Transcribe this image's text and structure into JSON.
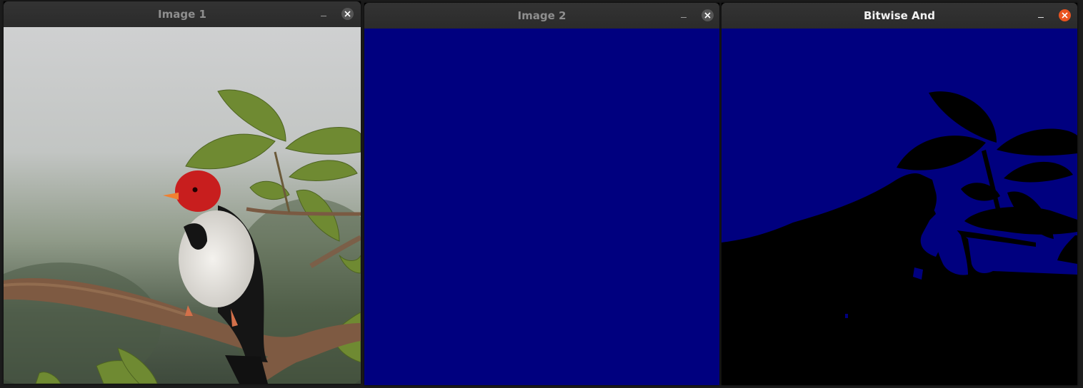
{
  "windows": [
    {
      "title": "Image 1",
      "active": false,
      "image": "bird-on-branch-photo"
    },
    {
      "title": "Image 2",
      "active": false,
      "image": "solid-blue-fill",
      "fill_color": "#00007f"
    },
    {
      "title": "Bitwise And",
      "active": true,
      "image": "masked-blue-result",
      "fill_color": "#00007f"
    }
  ],
  "colors": {
    "titlebar": "#2f2f2f",
    "title_inactive": "#8e8e8e",
    "title_active": "#f2f2f2",
    "close_active": "#e95420",
    "close_inactive": "#555555"
  },
  "icons": [
    "minimize-icon",
    "close-icon"
  ]
}
